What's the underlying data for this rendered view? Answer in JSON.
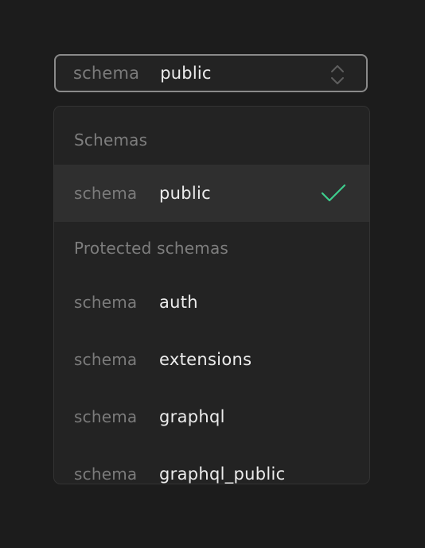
{
  "trigger": {
    "prefix": "schema",
    "value": "public"
  },
  "dropdown": {
    "groups": [
      {
        "heading": "Schemas",
        "options": [
          {
            "prefix": "schema",
            "name": "public",
            "selected": true
          }
        ]
      },
      {
        "heading": "Protected schemas",
        "options": [
          {
            "prefix": "schema",
            "name": "auth"
          },
          {
            "prefix": "schema",
            "name": "extensions"
          },
          {
            "prefix": "schema",
            "name": "graphql"
          },
          {
            "prefix": "schema",
            "name": "graphql_public"
          }
        ]
      }
    ]
  },
  "colors": {
    "background": "#1c1c1c",
    "panel": "#232323",
    "selected_row": "#2f2f2f",
    "check": "#3ecf8e",
    "muted_text": "#7b7b7b",
    "primary_text": "#ececec"
  },
  "icons": {
    "trigger": "chevron-up-down-icon",
    "selected": "check-icon"
  }
}
